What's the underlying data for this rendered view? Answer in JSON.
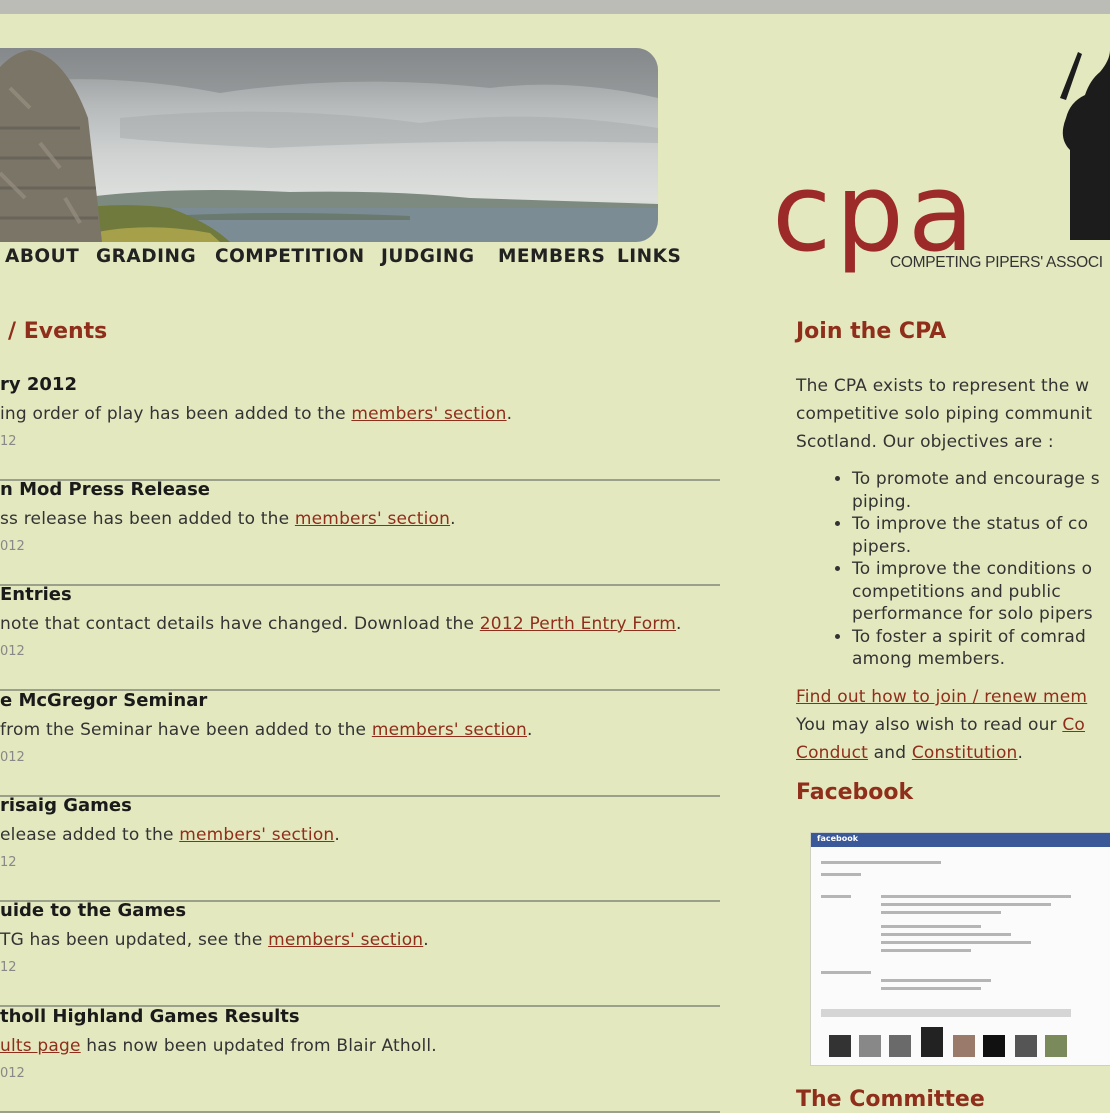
{
  "nav": {
    "items": [
      "ABOUT",
      "GRADING",
      "COMPETITION",
      "JUDGING",
      "MEMBERS",
      "LINKS"
    ]
  },
  "logo": {
    "text": "cpa",
    "subtitle": "COMPETING PIPERS' ASSOCI"
  },
  "news": {
    "heading": "/ Events",
    "items": [
      {
        "title": "ry 2012",
        "text": "ing order of play has been added to the ",
        "link": "members' section",
        "after": ".",
        "date": "12"
      },
      {
        "title": "n Mod Press Release",
        "text": "ss release has been added to the ",
        "link": "members' section",
        "after": ".",
        "date": "012"
      },
      {
        "title": "Entries",
        "text": "note that contact details have changed. Download the ",
        "link": "2012 Perth Entry Form",
        "after": ".",
        "date": "012"
      },
      {
        "title": "e McGregor Seminar",
        "text": "from the Seminar have been added to the ",
        "link": "members' section",
        "after": ".",
        "date": "012"
      },
      {
        "title": "risaig Games",
        "text": "elease added to the ",
        "link": "members' section",
        "after": ".",
        "date": "12"
      },
      {
        "title": "uide to the Games",
        "text": "TG has been updated, see the ",
        "link": "members' section",
        "after": ".",
        "date": "12"
      },
      {
        "title": "tholl Highland Games Results",
        "text": "",
        "link": "ults page",
        "after": " has now been updated from Blair Atholl.",
        "date": "012"
      }
    ]
  },
  "sidebar": {
    "join_heading": "Join the CPA",
    "intro_lines": [
      "The CPA exists to represent the w",
      "competitive solo piping communit",
      "Scotland. Our objectives are :"
    ],
    "objectives": [
      [
        "To promote and encourage s",
        "piping."
      ],
      [
        "To improve the status of co",
        "pipers."
      ],
      [
        "To improve the conditions o",
        "competitions and public",
        "performance for solo pipers"
      ],
      [
        "To foster a spirit of comrad",
        "among members."
      ]
    ],
    "join_link": "Find out how to join / renew mem",
    "read_text": "You may also wish to read our ",
    "read_link": "Co",
    "conduct_link": "Conduct",
    "and_text": " and ",
    "constitution_link": "Constitution",
    "period": ".",
    "facebook_heading": "Facebook",
    "facebook_brand": "facebook",
    "committee_heading": "The Committee"
  },
  "colors": {
    "background": "#e3e8bf",
    "heading": "#8f2e1a",
    "logo": "#9c2a28"
  }
}
